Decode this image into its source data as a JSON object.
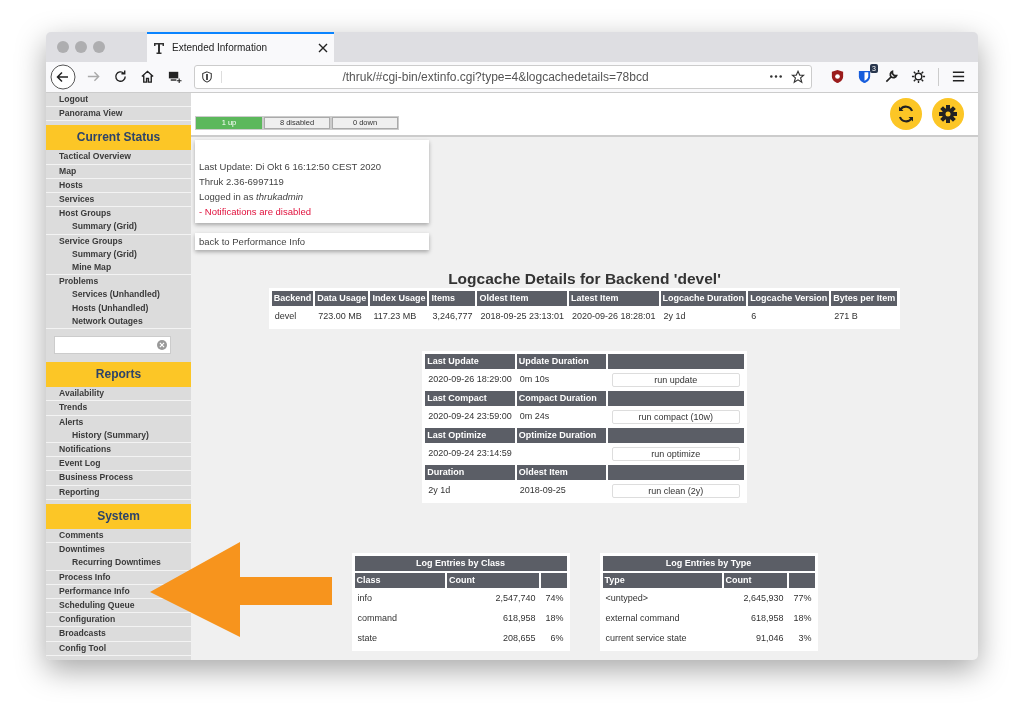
{
  "browser": {
    "tab_title": "Extended Information",
    "url": "/thruk/#cgi-bin/extinfo.cgi?type=4&logcachedetails=78bcd",
    "extension_badge": "3"
  },
  "sidebar": [
    {
      "kind": "links",
      "items": [
        {
          "label": "Logout"
        },
        {
          "label": "Panorama View"
        }
      ]
    },
    {
      "kind": "section",
      "title": "Current Status",
      "items": [
        {
          "label": "Tactical Overview"
        },
        {
          "label": "Map"
        },
        {
          "label": "Hosts"
        },
        {
          "label": "Services"
        },
        {
          "label": "Host Groups",
          "children": [
            {
              "label": "Summary (Grid)"
            }
          ]
        },
        {
          "label": "Service Groups",
          "children": [
            {
              "label": "Summary (Grid)"
            },
            {
              "label": "Mine Map"
            }
          ]
        },
        {
          "label": "Problems",
          "children": [
            {
              "label": "Services (Unhandled)"
            },
            {
              "label": "Hosts (Unhandled)"
            },
            {
              "label": "Network Outages"
            }
          ]
        }
      ]
    },
    {
      "kind": "search"
    },
    {
      "kind": "section",
      "title": "Reports",
      "items": [
        {
          "label": "Availability"
        },
        {
          "label": "Trends"
        },
        {
          "label": "Alerts",
          "children": [
            {
              "label": "History (Summary)"
            }
          ]
        },
        {
          "label": "Notifications"
        },
        {
          "label": "Event Log"
        },
        {
          "label": "Business Process"
        },
        {
          "label": "Reporting"
        }
      ]
    },
    {
      "kind": "section",
      "title": "System",
      "items": [
        {
          "label": "Comments"
        },
        {
          "label": "Downtimes",
          "children": [
            {
              "label": "Recurring Downtimes"
            }
          ]
        },
        {
          "label": "Process Info"
        },
        {
          "label": "Performance Info"
        },
        {
          "label": "Scheduling Queue"
        },
        {
          "label": "Configuration"
        },
        {
          "label": "Broadcasts"
        },
        {
          "label": "Config Tool"
        }
      ]
    }
  ],
  "backend_status": [
    {
      "label": "1 up",
      "selected": true
    },
    {
      "label": "8 disabled",
      "selected": false
    },
    {
      "label": "0 down",
      "selected": false
    }
  ],
  "info_card": [
    {
      "text": "Last Update: Di Okt 6 16:12:50 CEST 2020",
      "kind": "plain"
    },
    {
      "text": "Thruk 2.36-6997119",
      "kind": "plain"
    },
    {
      "text": "Logged in as *thrukadmin*",
      "kind": "plain"
    },
    {
      "text": "- Notifications are disabled",
      "kind": "alert"
    }
  ],
  "back_link": "back to Performance Info",
  "title": "Logcache Details for Backend 'devel'",
  "details_table": {
    "columns": [
      "Backend",
      "Data Usage",
      "Index Usage",
      "Items",
      "Oldest Item",
      "Latest Item",
      "Logcache Duration",
      "Logcache Version",
      "Bytes per Item"
    ],
    "rows": [
      [
        "devel",
        "723.00 MB",
        "117.23 MB",
        "3,246,777",
        "2018-09-25 23:13:01",
        "2020-09-26 18:28:01",
        "2y 1d",
        "6",
        "271 B"
      ]
    ]
  },
  "maintenance": [
    {
      "headers": [
        "Last Update",
        "Update Duration"
      ],
      "values": [
        "2020-09-26 18:29:00",
        "0m 10s"
      ],
      "button": "run update"
    },
    {
      "headers": [
        "Last Compact",
        "Compact Duration"
      ],
      "values": [
        "2020-09-24 23:59:00",
        "0m 24s"
      ],
      "button": "run compact (10w)"
    },
    {
      "headers": [
        "Last Optimize",
        "Optimize Duration"
      ],
      "values": [
        "2020-09-24 23:14:59"
      ],
      "button": "run optimize"
    },
    {
      "headers": [
        "Duration",
        "Oldest Item"
      ],
      "values": [
        "2y 1d",
        "2018-09-25"
      ],
      "button": "run clean (2y)"
    }
  ],
  "stats_tables": [
    {
      "title": "Log Entries by Class",
      "columns": [
        "Class",
        "Count"
      ],
      "rows": [
        [
          "info",
          "2,547,740",
          "74%"
        ],
        [
          "command",
          "618,958",
          "18%"
        ],
        [
          "state",
          "208,655",
          "6%"
        ]
      ]
    },
    {
      "title": "Log Entries by Type",
      "columns": [
        "Type",
        "Count"
      ],
      "rows": [
        [
          "<untyped>",
          "2,645,930",
          "77%"
        ],
        [
          "external command",
          "618,958",
          "18%"
        ],
        [
          "current service state",
          "91,046",
          "3%"
        ]
      ]
    }
  ]
}
